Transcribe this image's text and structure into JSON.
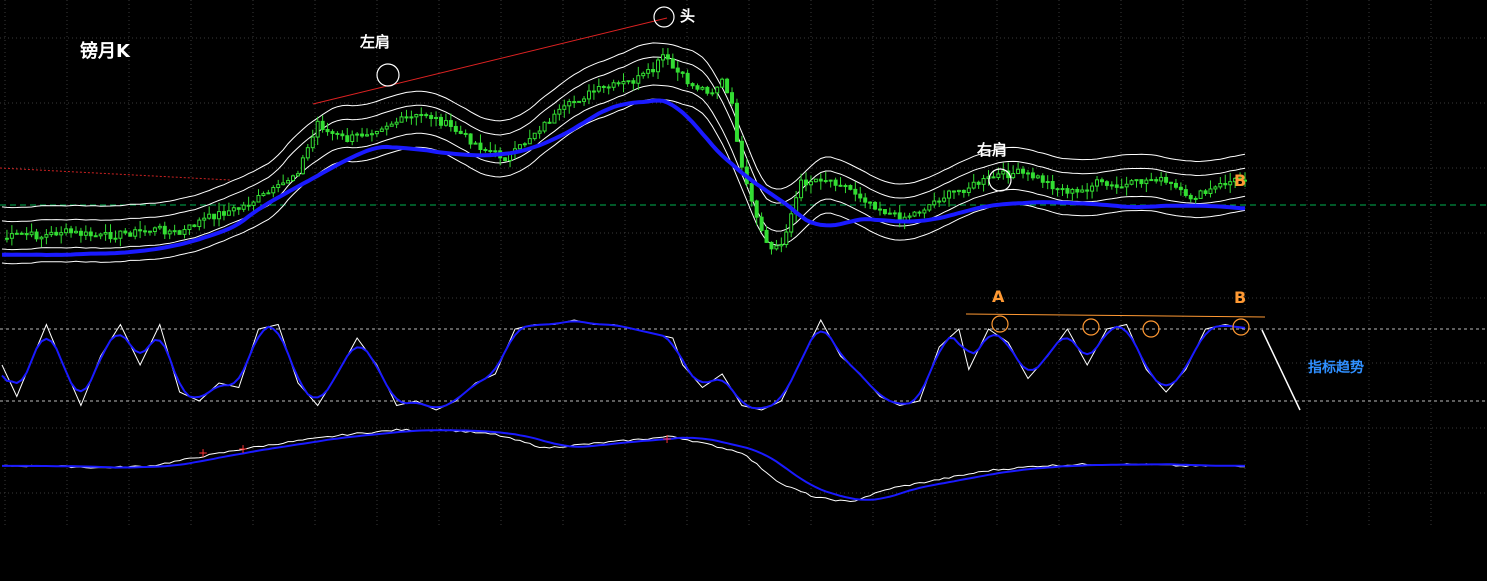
{
  "chart_data": {
    "type": "candlestick",
    "title": "镑月K",
    "annotations": {
      "left_shoulder": "左肩",
      "head": "头",
      "right_shoulder": "右肩",
      "point_a": "A",
      "point_b": "B",
      "indicator_trend": "指标趋势"
    },
    "colors": {
      "background": "#000000",
      "grid": "#3a3a3a",
      "candle": "#33dd33",
      "band": "#ffffff",
      "ma": "#1a1aff",
      "trendline": "#dd2222",
      "annotation": "#ffffff",
      "label_orange": "#ff9933",
      "label_blue": "#2f8fff",
      "guide_green": "#00b050",
      "level_line": "#ffffff"
    },
    "price_path": [
      [
        0,
        0.82
      ],
      [
        4,
        0.8
      ],
      [
        8,
        0.81
      ],
      [
        12,
        0.79
      ],
      [
        16,
        0.8
      ],
      [
        20,
        0.81
      ],
      [
        24,
        0.8
      ],
      [
        28,
        0.79
      ],
      [
        32,
        0.78
      ],
      [
        36,
        0.8
      ],
      [
        40,
        0.75
      ],
      [
        44,
        0.72
      ],
      [
        48,
        0.7
      ],
      [
        52,
        0.66
      ],
      [
        56,
        0.62
      ],
      [
        60,
        0.55
      ],
      [
        63,
        0.42
      ],
      [
        64,
        0.36
      ],
      [
        66,
        0.4
      ],
      [
        70,
        0.43
      ],
      [
        74,
        0.4
      ],
      [
        78,
        0.37
      ],
      [
        82,
        0.35
      ],
      [
        86,
        0.33
      ],
      [
        90,
        0.37
      ],
      [
        94,
        0.42
      ],
      [
        98,
        0.47
      ],
      [
        102,
        0.5
      ],
      [
        104,
        0.48
      ],
      [
        108,
        0.4
      ],
      [
        112,
        0.34
      ],
      [
        116,
        0.28
      ],
      [
        120,
        0.24
      ],
      [
        124,
        0.22
      ],
      [
        128,
        0.2
      ],
      [
        132,
        0.16
      ],
      [
        134,
        0.1
      ],
      [
        136,
        0.15
      ],
      [
        140,
        0.22
      ],
      [
        144,
        0.24
      ],
      [
        146,
        0.2
      ],
      [
        148,
        0.3
      ],
      [
        150,
        0.55
      ],
      [
        152,
        0.68
      ],
      [
        154,
        0.8
      ],
      [
        156,
        0.86
      ],
      [
        158,
        0.84
      ],
      [
        160,
        0.72
      ],
      [
        162,
        0.6
      ],
      [
        166,
        0.58
      ],
      [
        170,
        0.6
      ],
      [
        174,
        0.65
      ],
      [
        178,
        0.7
      ],
      [
        182,
        0.74
      ],
      [
        186,
        0.71
      ],
      [
        190,
        0.66
      ],
      [
        194,
        0.63
      ],
      [
        198,
        0.6
      ],
      [
        202,
        0.57
      ],
      [
        206,
        0.56
      ],
      [
        210,
        0.58
      ],
      [
        214,
        0.62
      ],
      [
        218,
        0.64
      ],
      [
        222,
        0.6
      ],
      [
        226,
        0.62
      ],
      [
        230,
        0.6
      ],
      [
        234,
        0.58
      ],
      [
        238,
        0.62
      ],
      [
        240,
        0.66
      ],
      [
        244,
        0.64
      ],
      [
        248,
        0.6
      ],
      [
        252,
        0.58
      ]
    ],
    "indicator_oscillator": [
      [
        0,
        0.5
      ],
      [
        3,
        0.15
      ],
      [
        6,
        0.55
      ],
      [
        9,
        0.95
      ],
      [
        12,
        0.55
      ],
      [
        16,
        0.05
      ],
      [
        20,
        0.6
      ],
      [
        24,
        0.95
      ],
      [
        28,
        0.5
      ],
      [
        32,
        0.95
      ],
      [
        36,
        0.2
      ],
      [
        40,
        0.1
      ],
      [
        44,
        0.3
      ],
      [
        48,
        0.25
      ],
      [
        52,
        0.9
      ],
      [
        56,
        0.95
      ],
      [
        60,
        0.3
      ],
      [
        64,
        0.05
      ],
      [
        68,
        0.4
      ],
      [
        72,
        0.8
      ],
      [
        76,
        0.5
      ],
      [
        80,
        0.05
      ],
      [
        84,
        0.1
      ],
      [
        88,
        0.0
      ],
      [
        92,
        0.1
      ],
      [
        96,
        0.3
      ],
      [
        100,
        0.4
      ],
      [
        104,
        0.9
      ],
      [
        108,
        0.95
      ],
      [
        112,
        0.95
      ],
      [
        116,
        1.0
      ],
      [
        120,
        0.95
      ],
      [
        124,
        0.95
      ],
      [
        128,
        0.9
      ],
      [
        132,
        0.85
      ],
      [
        136,
        0.8
      ],
      [
        138,
        0.5
      ],
      [
        142,
        0.25
      ],
      [
        146,
        0.4
      ],
      [
        150,
        0.05
      ],
      [
        154,
        0.0
      ],
      [
        158,
        0.1
      ],
      [
        162,
        0.55
      ],
      [
        166,
        1.0
      ],
      [
        170,
        0.6
      ],
      [
        174,
        0.4
      ],
      [
        178,
        0.15
      ],
      [
        182,
        0.05
      ],
      [
        186,
        0.1
      ],
      [
        190,
        0.7
      ],
      [
        194,
        0.9
      ],
      [
        196,
        0.45
      ],
      [
        200,
        0.9
      ],
      [
        204,
        0.75
      ],
      [
        208,
        0.35
      ],
      [
        212,
        0.6
      ],
      [
        216,
        0.9
      ],
      [
        220,
        0.5
      ],
      [
        224,
        0.9
      ],
      [
        228,
        0.95
      ],
      [
        232,
        0.45
      ],
      [
        236,
        0.2
      ],
      [
        240,
        0.45
      ],
      [
        244,
        0.9
      ],
      [
        248,
        0.95
      ],
      [
        252,
        0.9
      ]
    ],
    "indicator_slow": [
      [
        0,
        0.6
      ],
      [
        10,
        0.6
      ],
      [
        20,
        0.58
      ],
      [
        30,
        0.6
      ],
      [
        40,
        0.7
      ],
      [
        50,
        0.8
      ],
      [
        60,
        0.88
      ],
      [
        70,
        0.95
      ],
      [
        80,
        1.0
      ],
      [
        90,
        1.0
      ],
      [
        100,
        0.95
      ],
      [
        110,
        0.8
      ],
      [
        120,
        0.85
      ],
      [
        130,
        0.9
      ],
      [
        136,
        0.93
      ],
      [
        140,
        0.88
      ],
      [
        150,
        0.75
      ],
      [
        158,
        0.4
      ],
      [
        165,
        0.25
      ],
      [
        172,
        0.2
      ],
      [
        180,
        0.35
      ],
      [
        190,
        0.45
      ],
      [
        200,
        0.55
      ],
      [
        210,
        0.6
      ],
      [
        220,
        0.62
      ],
      [
        230,
        0.62
      ],
      [
        240,
        0.6
      ],
      [
        252,
        0.6
      ]
    ]
  }
}
